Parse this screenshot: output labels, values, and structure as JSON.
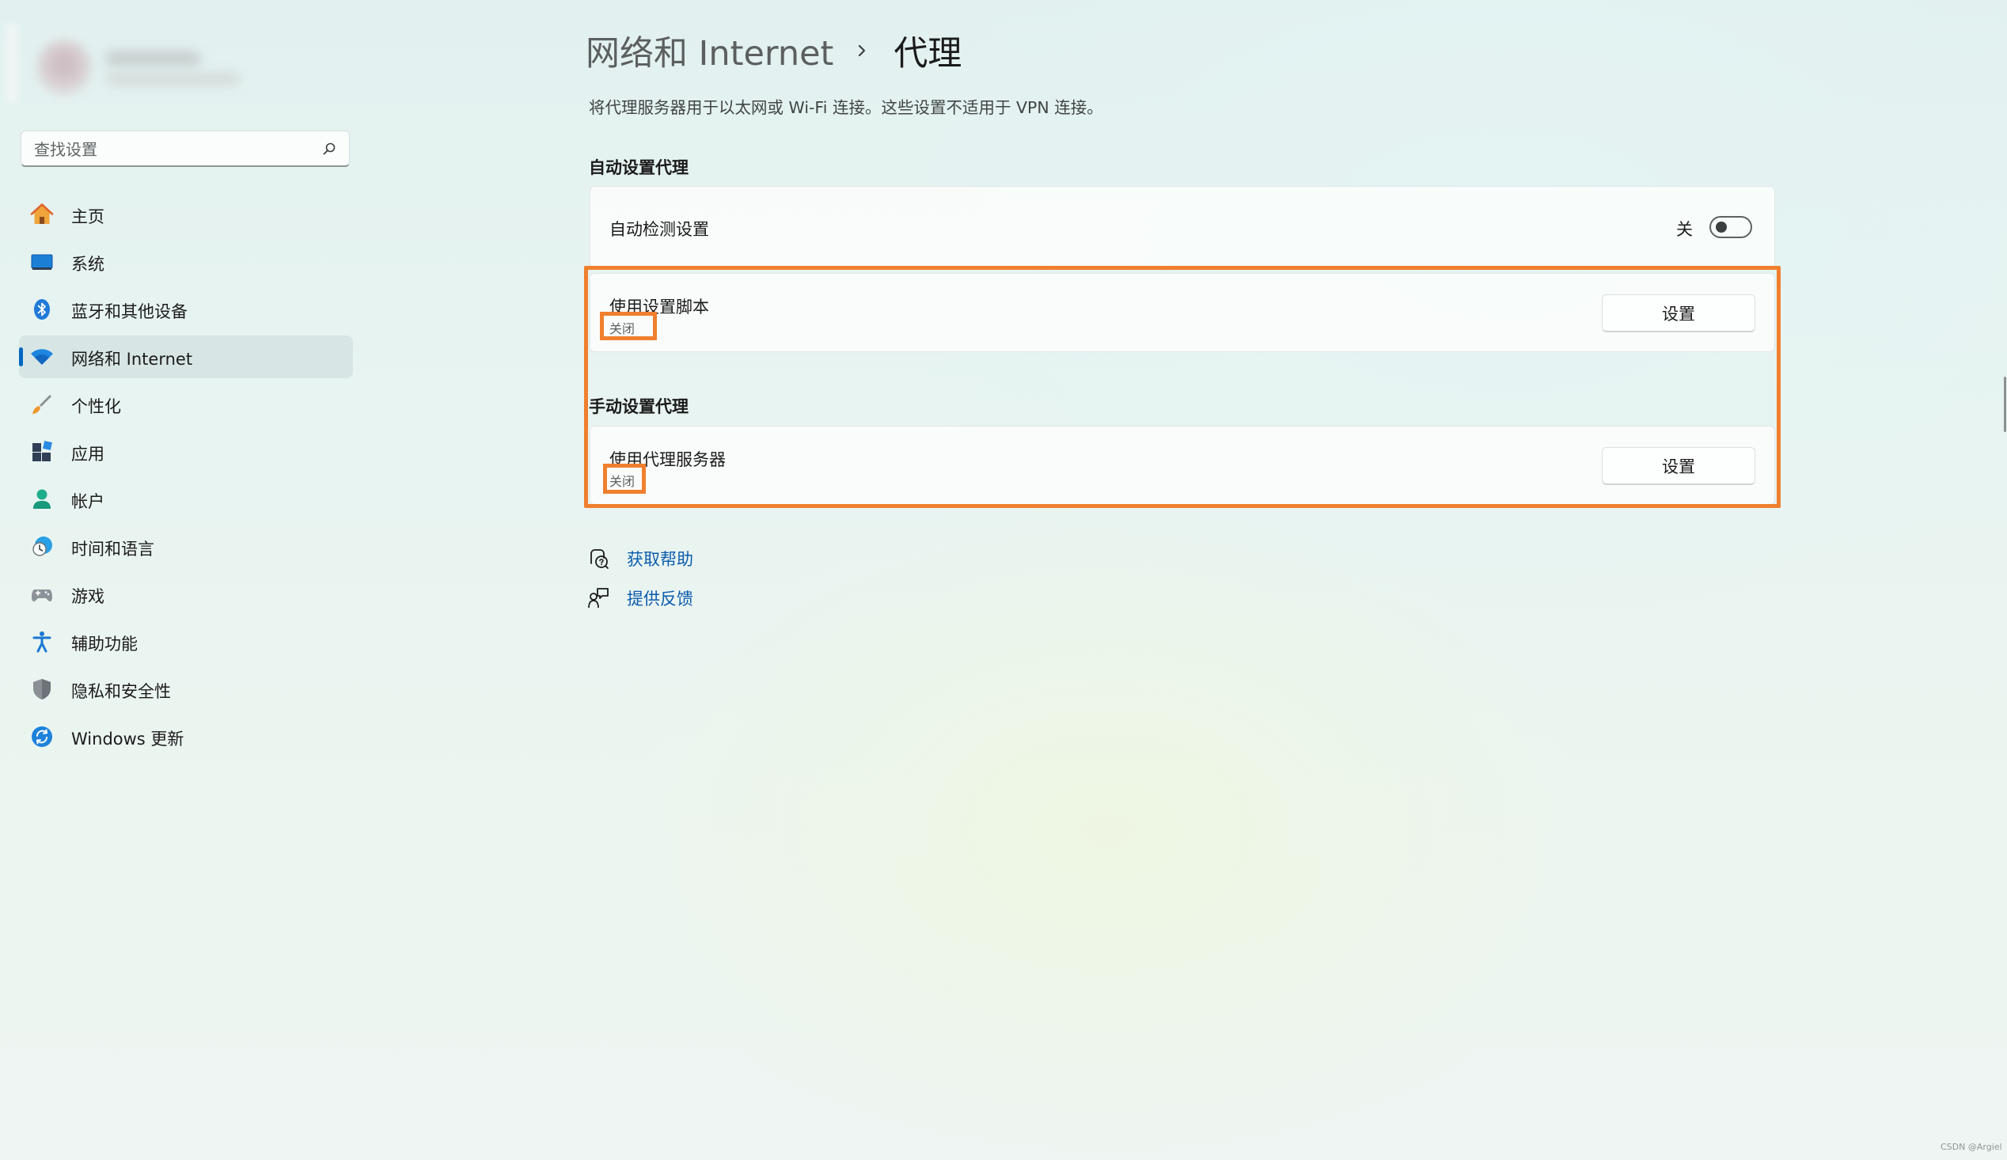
{
  "sidebar": {
    "search": {
      "placeholder": "查找设置"
    },
    "items": [
      {
        "label": "主页",
        "icon": "home-icon"
      },
      {
        "label": "系统",
        "icon": "system-display-icon"
      },
      {
        "label": "蓝牙和其他设备",
        "icon": "bluetooth-icon"
      },
      {
        "label": "网络和 Internet",
        "icon": "wifi-icon",
        "selected": true
      },
      {
        "label": "个性化",
        "icon": "paintbrush-icon"
      },
      {
        "label": "应用",
        "icon": "apps-icon"
      },
      {
        "label": "帐户",
        "icon": "account-icon"
      },
      {
        "label": "时间和语言",
        "icon": "time-language-icon"
      },
      {
        "label": "游戏",
        "icon": "gamepad-icon"
      },
      {
        "label": "辅助功能",
        "icon": "accessibility-icon"
      },
      {
        "label": "隐私和安全性",
        "icon": "shield-icon"
      },
      {
        "label": "Windows 更新",
        "icon": "windows-update-icon"
      }
    ]
  },
  "header": {
    "breadcrumb_parent": "网络和 Internet",
    "breadcrumb_current": "代理",
    "description": "将代理服务器用于以太网或 Wi-Fi 连接。这些设置不适用于 VPN 连接。"
  },
  "auto_section": {
    "title": "自动设置代理",
    "auto_detect": {
      "label": "自动检测设置",
      "toggle_state": "关",
      "toggle_on": false
    },
    "script": {
      "label": "使用设置脚本",
      "status": "关闭",
      "button": "设置"
    }
  },
  "manual_section": {
    "title": "手动设置代理",
    "proxy": {
      "label": "使用代理服务器",
      "status": "关闭",
      "button": "设置"
    }
  },
  "links": {
    "help": "获取帮助",
    "feedback": "提供反馈"
  },
  "colors": {
    "accent": "#0067c0",
    "link": "#0b5cad",
    "highlight": "#f07f2e"
  },
  "watermark": "CSDN @Argiel"
}
